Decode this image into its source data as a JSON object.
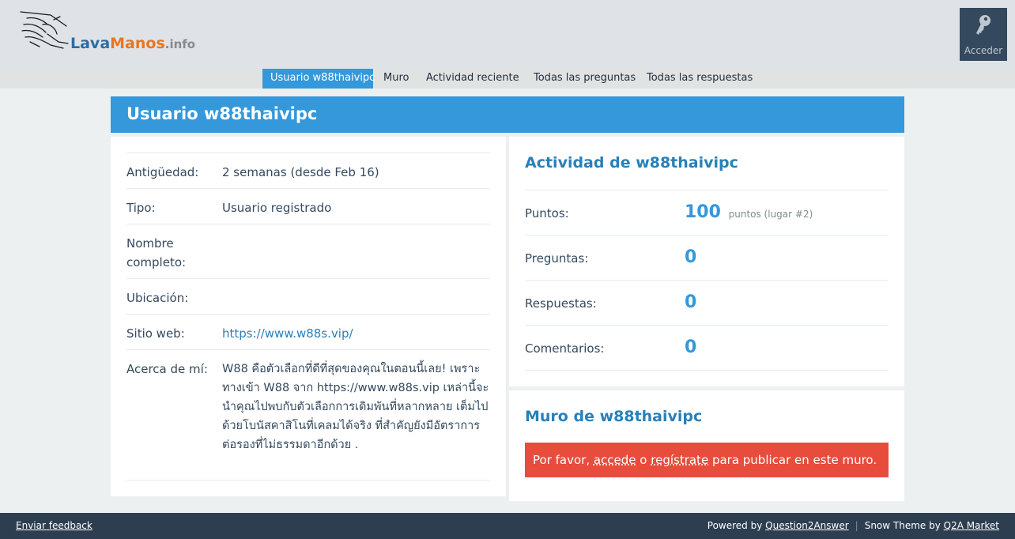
{
  "header": {
    "logo": {
      "part1": "Lava",
      "part2": "Manos",
      "part3": ".info"
    },
    "login": {
      "label": "Acceder",
      "icon": "key-icon"
    }
  },
  "nav": {
    "items": [
      {
        "label": "Usuario w88thaivipc",
        "active": true
      },
      {
        "label": "Muro"
      },
      {
        "label": "Actividad reciente"
      },
      {
        "label": "Todas las preguntas"
      },
      {
        "label": "Todas las respuestas"
      }
    ]
  },
  "page": {
    "title": "Usuario w88thaivipc"
  },
  "profile": {
    "rows": [
      {
        "label": "Antigüedad:",
        "value": "2 semanas (desde Feb 16)"
      },
      {
        "label": "Tipo:",
        "value": "Usuario registrado"
      },
      {
        "label": "Nombre completo:",
        "value": ""
      },
      {
        "label": "Ubicación:",
        "value": ""
      },
      {
        "label": "Sitio web:",
        "value": "https://www.w88s.vip/"
      },
      {
        "label": "Acerca de mí:",
        "value": "W88 คือตัวเลือกที่ดีที่สุดของคุณในตอนนี้เลย! เพราะทางเข้า W88 จาก https://www.w88s.vip เหล่านี้จะนำคุณไปพบกับตัวเลือกการเดิมพันที่หลากหลาย เต็มไปด้วยโบนัสคาสิโนที่เคลมได้จริง ที่สำคัญยังมีอัตราการต่อรองที่ไม่ธรรมดาอีกด้วย ."
      }
    ]
  },
  "activity": {
    "heading": "Actividad de w88thaivipc",
    "stats": [
      {
        "label": "Puntos:",
        "value": "100",
        "extra": "puntos (lugar #2)"
      },
      {
        "label": "Preguntas:",
        "value": "0"
      },
      {
        "label": "Respuestas:",
        "value": "0"
      },
      {
        "label": "Comentarios:",
        "value": "0"
      }
    ]
  },
  "wall": {
    "heading": "Muro de w88thaivipc",
    "alert": {
      "prefix": "Por favor, ",
      "login_link": "accede",
      "middle": " o ",
      "register_link": "regístrate",
      "suffix": " para publicar en este muro."
    }
  },
  "footer": {
    "feedback": "Enviar feedback",
    "powered_prefix": "Powered by ",
    "powered_link": "Question2Answer",
    "theme_prefix": "Snow Theme by ",
    "theme_link": "Q2A Market"
  },
  "colors": {
    "accent": "#3498db",
    "header_bg": "#dfe3e8",
    "footer_bg": "#2c3e50",
    "alert": "#e74c3c"
  }
}
